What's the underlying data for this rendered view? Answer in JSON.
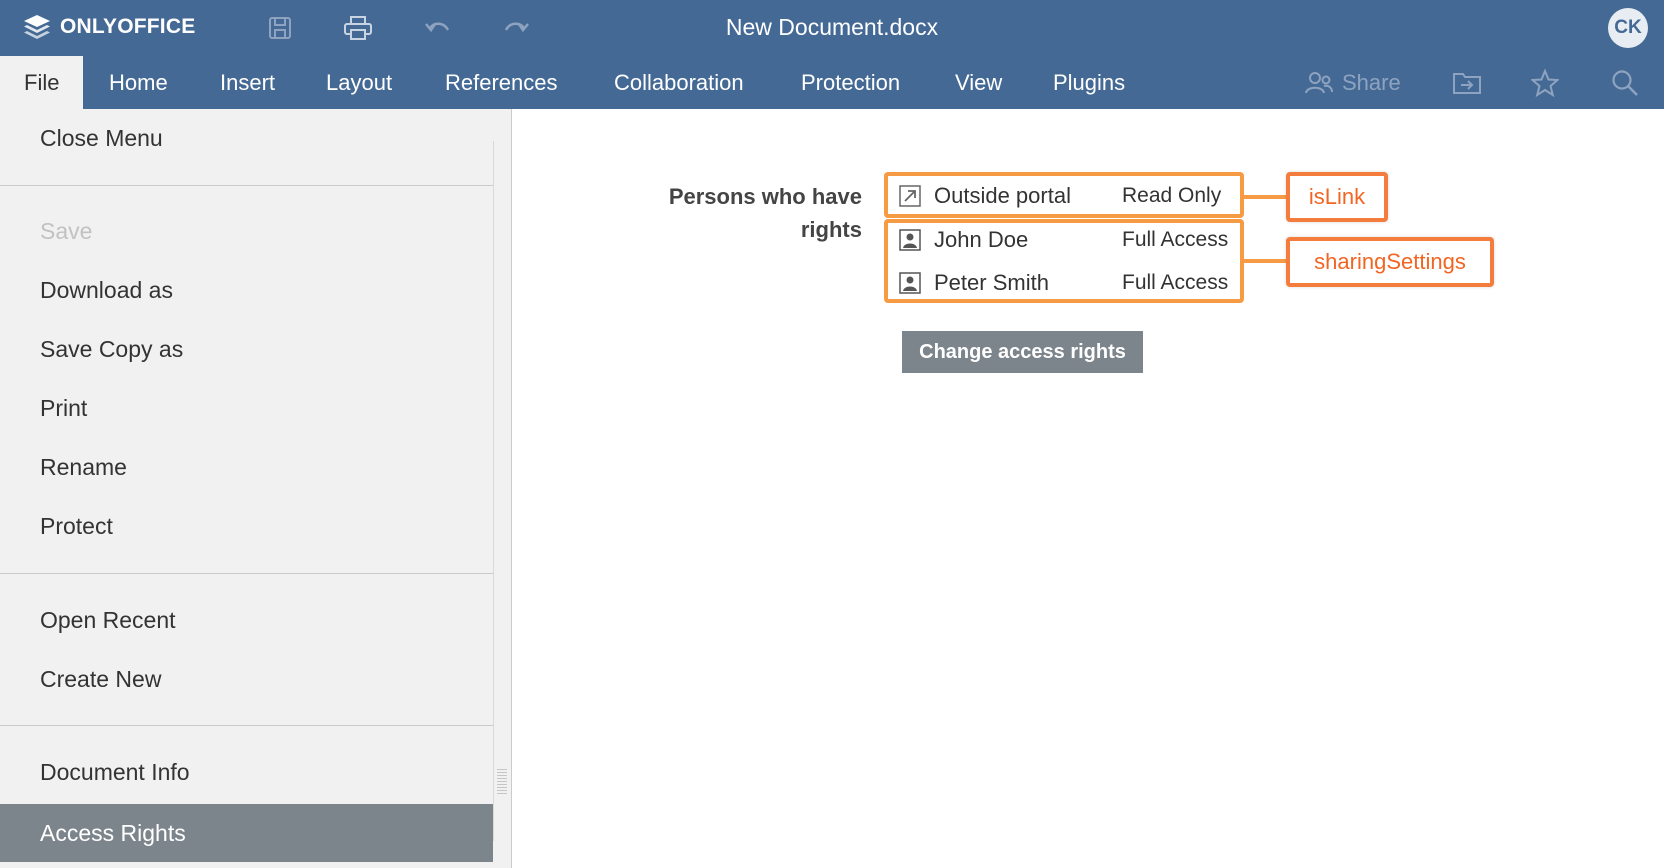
{
  "app": {
    "name": "ONLYOFFICE",
    "document_title": "New Document.docx",
    "user_initials": "CK"
  },
  "toolbar": {
    "icons": [
      "save-icon",
      "print-icon",
      "undo-icon",
      "redo-icon"
    ]
  },
  "menu": {
    "tabs": [
      "File",
      "Home",
      "Insert",
      "Layout",
      "References",
      "Collaboration",
      "Protection",
      "View",
      "Plugins"
    ],
    "active_tab": "File",
    "share_label": "Share",
    "right_icons": [
      "share-icon",
      "open-location-icon",
      "favorite-star-icon",
      "search-icon"
    ]
  },
  "file_menu": {
    "items": [
      {
        "label": "Close Menu",
        "state": "normal"
      },
      {
        "label": "Save",
        "state": "disabled"
      },
      {
        "label": "Download as",
        "state": "normal"
      },
      {
        "label": "Save Copy as",
        "state": "normal"
      },
      {
        "label": "Print",
        "state": "normal"
      },
      {
        "label": "Rename",
        "state": "normal"
      },
      {
        "label": "Protect",
        "state": "normal"
      },
      {
        "label": "Open Recent",
        "state": "normal"
      },
      {
        "label": "Create New",
        "state": "normal"
      },
      {
        "label": "Document Info",
        "state": "normal"
      },
      {
        "label": "Access Rights",
        "state": "selected"
      }
    ]
  },
  "access_rights": {
    "label": "Persons who have rights",
    "entries": [
      {
        "icon": "link-arrow-icon",
        "name": "Outside portal",
        "permission": "Read Only"
      },
      {
        "icon": "user-icon",
        "name": "John Doe",
        "permission": "Full Access"
      },
      {
        "icon": "user-icon",
        "name": "Peter Smith",
        "permission": "Full Access"
      }
    ],
    "change_button": "Change access rights"
  },
  "annotations": {
    "is_link": "isLink",
    "sharing_settings": "sharingSettings",
    "color": "#f79a44"
  },
  "colors": {
    "header": "#446995",
    "panel": "#f1f1f1",
    "selected": "#7d858c"
  }
}
